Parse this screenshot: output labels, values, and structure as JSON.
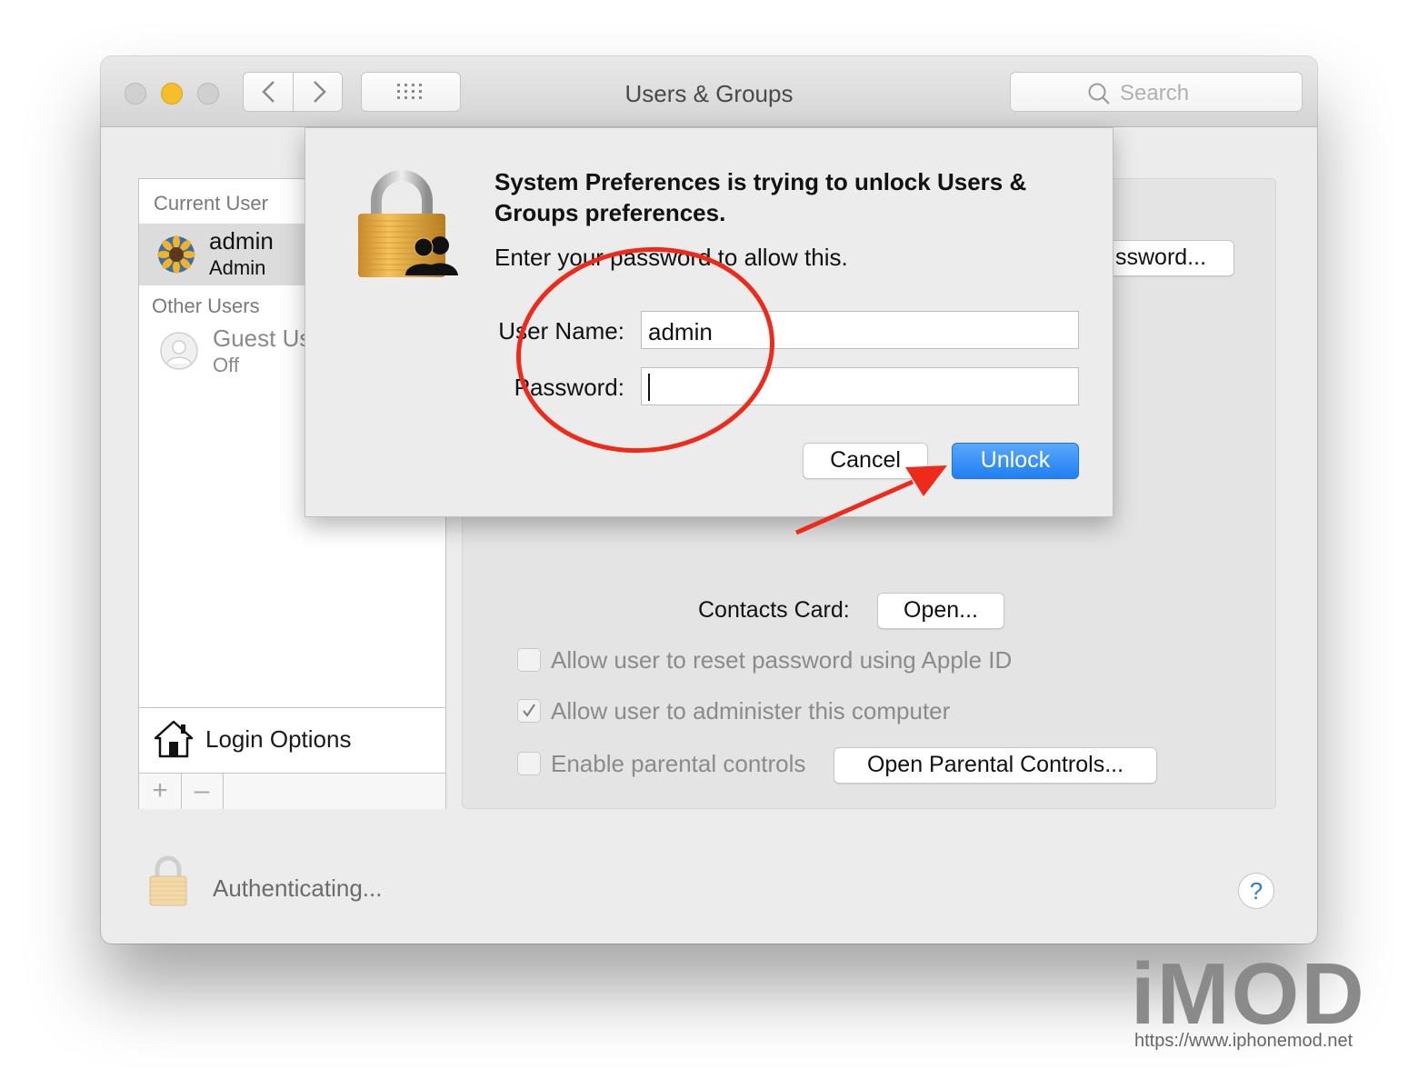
{
  "window": {
    "title": "Users & Groups",
    "search_placeholder": "Search"
  },
  "sidebar": {
    "current_user_header": "Current User",
    "current_user": {
      "name": "admin",
      "role": "Admin"
    },
    "other_users_header": "Other Users",
    "other_users": [
      {
        "name": "Guest Us",
        "status": "Off"
      }
    ],
    "login_options_label": "Login Options",
    "add_label": "+",
    "remove_label": "–"
  },
  "content": {
    "password_button_label": "ssword...",
    "contacts_card_label": "Contacts Card:",
    "open_button_label": "Open...",
    "checkboxes": [
      {
        "label": "Allow user to reset password using Apple ID",
        "checked": false
      },
      {
        "label": "Allow user to administer this computer",
        "checked": true
      },
      {
        "label": "Enable parental controls",
        "checked": false
      }
    ],
    "parental_button_label": "Open Parental Controls..."
  },
  "footer": {
    "status_text": "Authenticating...",
    "help_label": "?"
  },
  "dialog": {
    "title": "System Preferences is trying to unlock Users & Groups preferences.",
    "message": "Enter your password to allow this.",
    "username_label": "User Name:",
    "username_value": "admin",
    "password_label": "Password:",
    "password_value": "",
    "cancel_label": "Cancel",
    "unlock_label": "Unlock"
  },
  "watermark": {
    "logo_text": "iMOD",
    "url": "https://www.iphonemod.net"
  },
  "colors": {
    "accent_blue": "#1f7ff2",
    "annotation_red": "#ee2a1b",
    "lock_gold": "#e8a93c",
    "minimize_yellow": "#f6bd2d"
  },
  "icons": [
    "back-chevron-icon",
    "forward-chevron-icon",
    "grid-icon",
    "search-icon",
    "lock-users-icon",
    "house-icon",
    "padlock-icon",
    "help-icon"
  ]
}
